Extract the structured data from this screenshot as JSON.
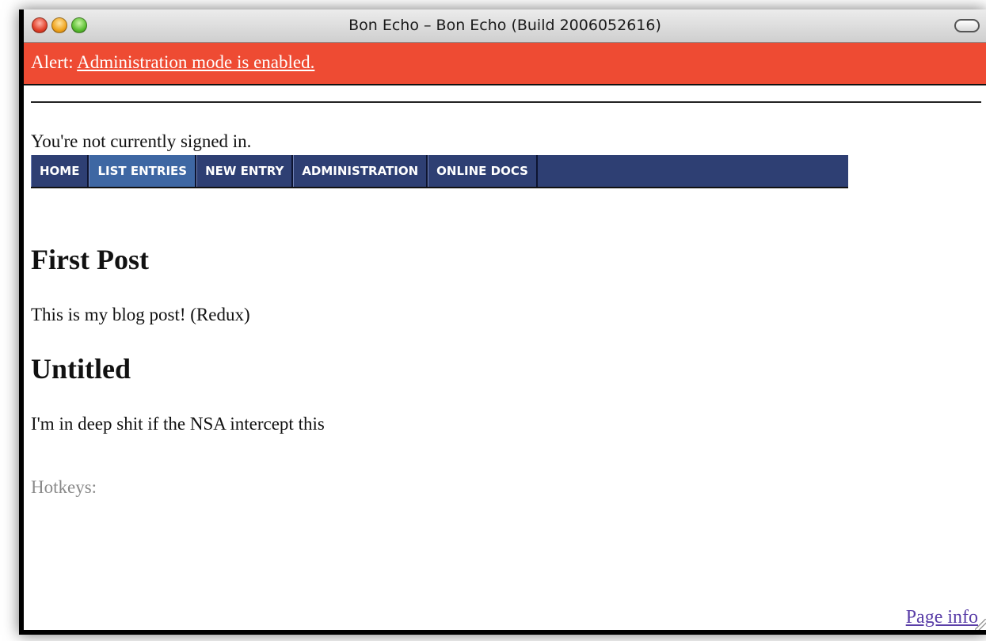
{
  "window": {
    "title": "Bon Echo – Bon Echo (Build 2006052616)"
  },
  "alert": {
    "prefix": "Alert: ",
    "link_text": "Administration mode is enabled."
  },
  "status": {
    "signin_text": "You're not currently signed in."
  },
  "nav": {
    "tabs": [
      {
        "label": "HOME",
        "active": false
      },
      {
        "label": "LIST ENTRIES",
        "active": true
      },
      {
        "label": "NEW ENTRY",
        "active": false
      },
      {
        "label": "ADMINISTRATION",
        "active": false
      },
      {
        "label": "ONLINE DOCS",
        "active": false
      }
    ]
  },
  "posts": [
    {
      "title": "First Post",
      "body": "This is my blog post! (Redux)"
    },
    {
      "title": "Untitled",
      "body": "I'm in deep shit if the NSA intercept this"
    }
  ],
  "footer": {
    "hotkeys_label": "Hotkeys:",
    "page_info_link": "Page info"
  },
  "colors": {
    "alert_bg": "#ee4b33",
    "nav_bg": "#2e3f73",
    "nav_active_bg": "#3e67a3",
    "link_visited": "#5a3ea8"
  },
  "icons": {
    "close": "close-button-icon",
    "minimize": "minimize-button-icon",
    "zoom": "zoom-button-icon",
    "toolbar_toggle": "toolbar-toggle-icon",
    "resize": "resize-grip-icon"
  }
}
